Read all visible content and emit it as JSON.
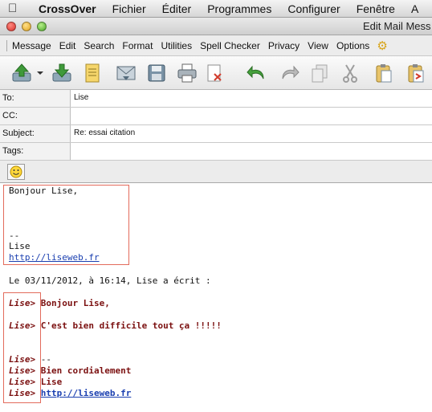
{
  "mac_menu": {
    "app_name": "CrossOver",
    "items": [
      "Fichier",
      "Éditer",
      "Programmes",
      "Configurer",
      "Fenêtre",
      "A"
    ]
  },
  "window": {
    "title": "Edit Mail Mess"
  },
  "menu": [
    "Message",
    "Edit",
    "Search",
    "Format",
    "Utilities",
    "Spell Checker",
    "Privacy",
    "View",
    "Options"
  ],
  "headers": {
    "to_label": "To:",
    "to_value": "Lise",
    "cc_label": "CC:",
    "cc_value": "",
    "subject_label": "Subject:",
    "subject_value": "Re: essai citation",
    "tags_label": "Tags:",
    "tags_value": ""
  },
  "body": {
    "greeting": "Bonjour Lise,",
    "sig_sep": "--",
    "sig_name": "Lise",
    "sig_link": "http://liseweb.fr",
    "attribution": "Le 03/11/2012, à 16:14, Lise a écrit :",
    "quote_marker": "Lise>",
    "quote_lines": {
      "q1": "Bonjour Lise,",
      "q2": "C'est bien difficile tout ça !!!!!",
      "q3": "--",
      "q4": "Bien cordialement",
      "q5": "Lise",
      "q6": "http://liseweb.fr"
    }
  }
}
